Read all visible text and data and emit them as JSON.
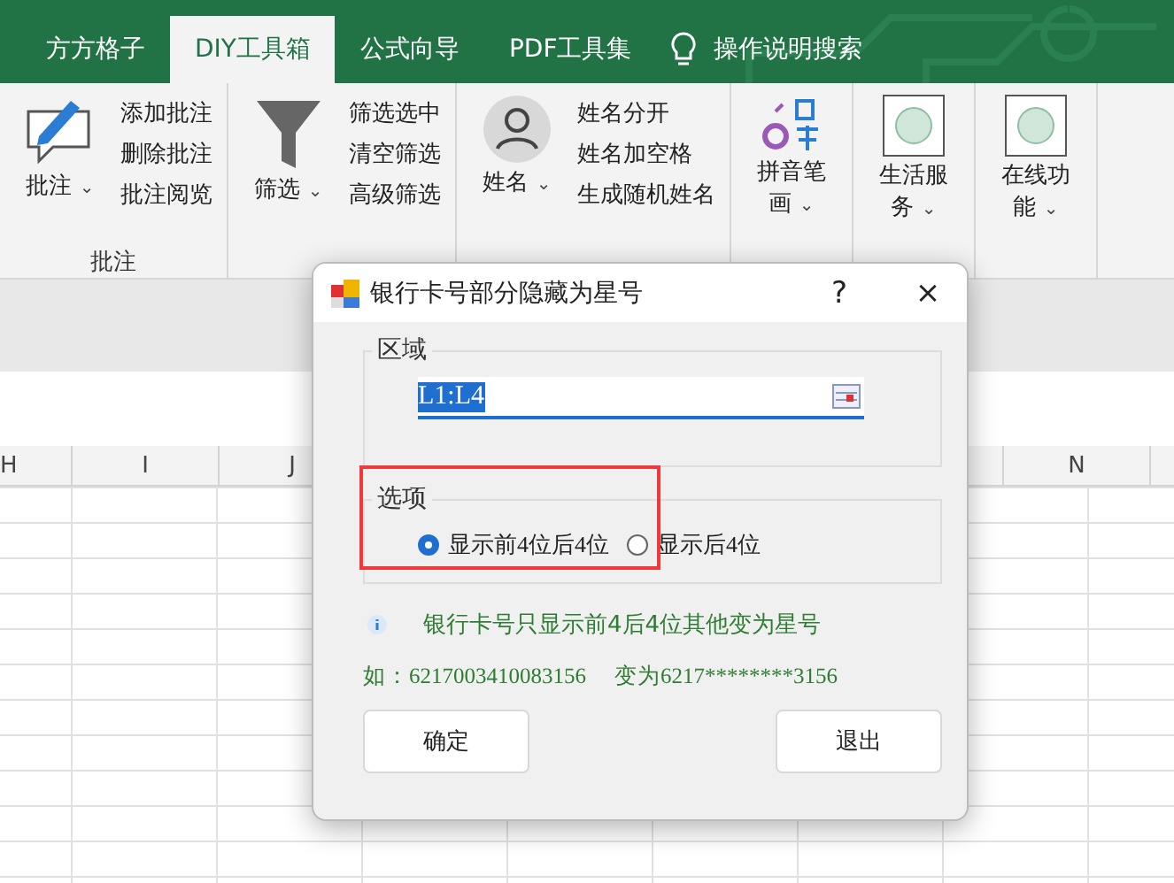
{
  "tabs": [
    {
      "label": "方方格子",
      "selected": false
    },
    {
      "label": "DIY工具箱",
      "selected": true
    },
    {
      "label": "公式向导",
      "selected": false
    },
    {
      "label": "PDF工具集",
      "selected": false
    }
  ],
  "search": {
    "label": "操作说明搜索"
  },
  "ribbon_groups": [
    {
      "large": "批注",
      "caret": "⌄",
      "small": [
        "添加批注",
        "删除批注",
        "批注阅览"
      ],
      "label": "批注"
    },
    {
      "large": "筛选",
      "caret": "⌄",
      "small": [
        "筛选选中",
        "清空筛选",
        "高级筛选"
      ]
    },
    {
      "large": "姓名",
      "caret": "⌄",
      "small": [
        "姓名分开",
        "姓名加空格",
        "生成随机姓名"
      ]
    },
    {
      "large": "拼音笔画",
      "caret": "⌄"
    },
    {
      "large": "生活服务",
      "caret": "⌄"
    },
    {
      "large": "在线功能",
      "caret": "⌄"
    }
  ],
  "columns": [
    "H",
    "I",
    "J",
    "",
    "",
    "",
    "N",
    ""
  ],
  "dialog": {
    "title": "银行卡号部分隐藏为星号",
    "help": "?",
    "close": "×",
    "range_group": {
      "label": "区域",
      "value": "L1:L4"
    },
    "options_group": {
      "label": "选项",
      "options": [
        {
          "label": "显示前4位后4位",
          "selected": true
        },
        {
          "label": "显示后4位",
          "selected": false
        }
      ]
    },
    "info": "银行卡号只显示前4后4位其他变为星号",
    "example": [
      "如：6217003410083156",
      "变为6217********3156"
    ],
    "buttons": [
      "确定",
      "退出"
    ]
  }
}
